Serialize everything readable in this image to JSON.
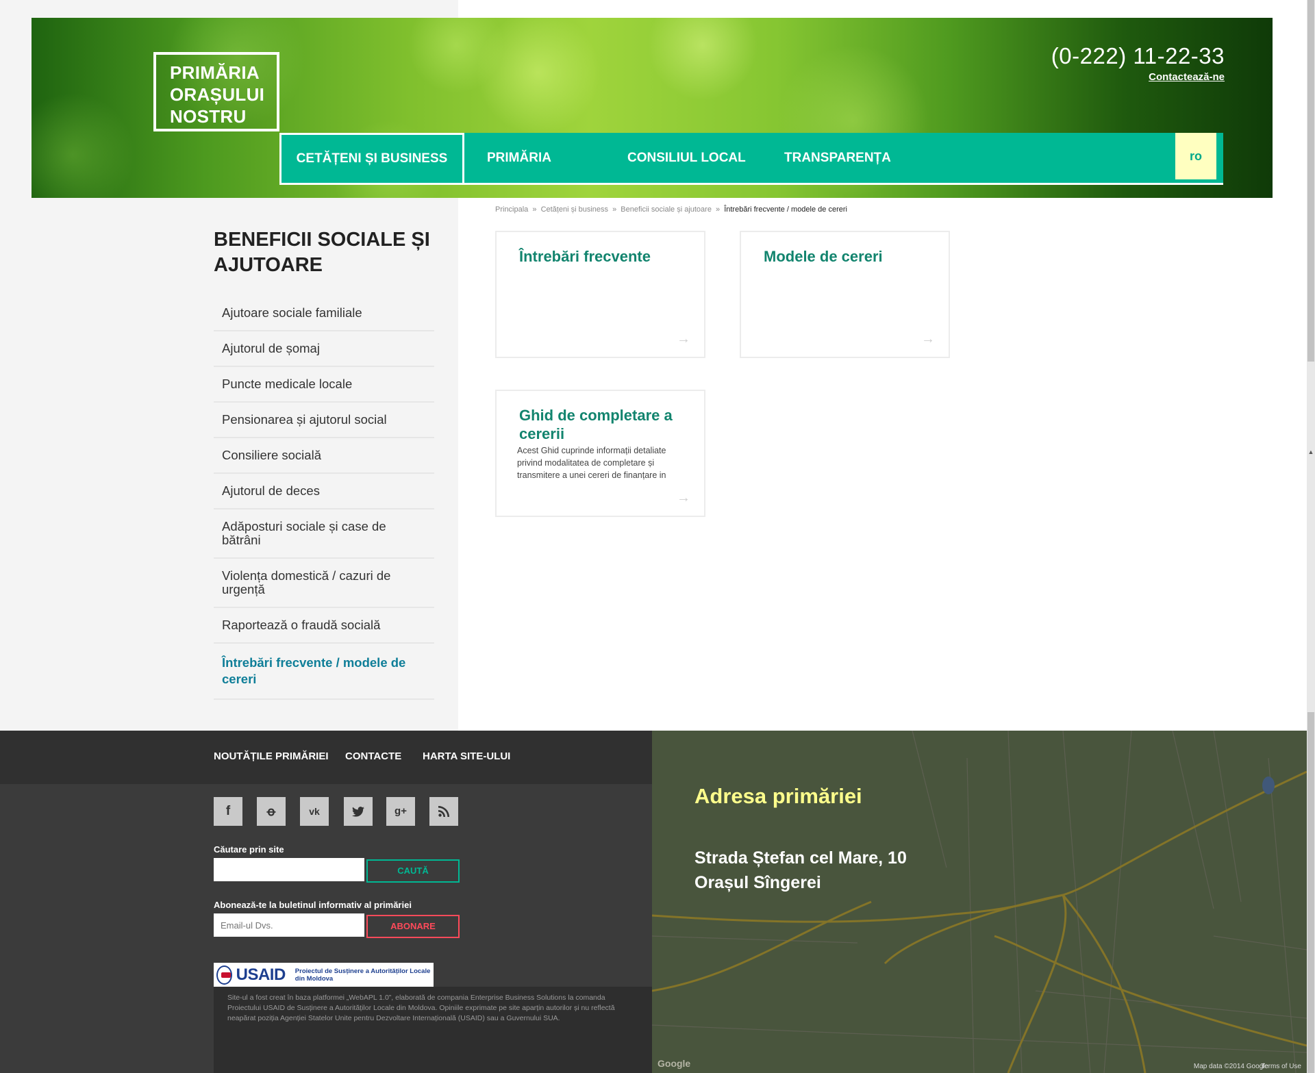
{
  "header": {
    "logo_lines": [
      "PRIMĂRIA",
      "ORAȘULUI",
      "NOSTRU"
    ],
    "phone": "(0-222) 11-22-33",
    "contact_link": "Contactează-ne",
    "nav": [
      "CETĂȚENI ȘI BUSINESS",
      "PRIMĂRIA",
      "CONSILIUL LOCAL",
      "TRANSPARENȚA"
    ],
    "lang": "ro"
  },
  "breadcrumb": {
    "items": [
      "Principala",
      "Cetățeni și business",
      "Beneficii sociale și ajutoare"
    ],
    "separator": "»",
    "current": "Întrebări frecvente / modele de cereri"
  },
  "sidebar": {
    "title": "BENEFICII SOCIALE ȘI AJUTOARE",
    "items": [
      "Ajutoare sociale familiale",
      "Ajutorul de șomaj",
      "Puncte medicale locale",
      "Pensionarea și ajutorul social",
      "Consiliere socială",
      "Ajutorul de deces",
      "Adăposturi sociale și case de bătrâni",
      "Violența domestică / cazuri de urgență",
      "Raportează o fraudă socială",
      "Întrebări frecvente / modele de cereri"
    ]
  },
  "cards": [
    {
      "title": "Întrebări frecvente",
      "desc": ""
    },
    {
      "title": "Modele de cereri",
      "desc": ""
    },
    {
      "title": "Ghid de completare a cererii",
      "desc": "Acest Ghid cuprinde informații detaliate privind modalitatea de completare și transmitere a unei cereri de finanțare in"
    }
  ],
  "footer": {
    "links": [
      "NOUTĂȚILE PRIMĂRIEI",
      "CONTACTE",
      "HARTA SITE-ULUI"
    ],
    "social_icons": [
      "facebook-icon",
      "odnoklassniki-icon",
      "vk-icon",
      "twitter-icon",
      "google-plus-icon",
      "rss-icon"
    ],
    "search_label": "Căutare prin site",
    "search_button": "CAUTĂ",
    "subscribe_label": "Abonează-te la buletinul informativ al primăriei",
    "email_placeholder": "Email-ul Dvs.",
    "subscribe_button": "ABONARE",
    "usaid_name": "USAID",
    "usaid_project": "Proiectul de Susținere a Autorităților Locale din Moldova",
    "disclaimer": "Site-ul a fost creat în baza platformei „WebAPL 1.0”, elaborată de compania Enterprise Business Solutions la comanda Proiectului USAID de Susținere a Autorităților Locale din Moldova. Opiniile exprimate pe site aparțin autorilor și nu reflectă neapărat poziția Agenției Statelor Unite pentru Dezvoltare Internațională (USAID) sau a Guvernului SUA."
  },
  "map": {
    "title": "Adresa primăriei",
    "address_line1": "Strada Ștefan cel Mare, 10",
    "address_line2": "Orașul Sîngerei",
    "google": "Google",
    "map_data": "Map data ©2014 Google",
    "terms": "Terms of Use"
  },
  "colors": {
    "accent_teal": "#00b894",
    "card_title": "#12846e",
    "active_link": "#0f7e98",
    "lang_bg": "#ffffc0",
    "map_title": "#ffff8c",
    "subscribe_red": "#ff4a5a"
  }
}
